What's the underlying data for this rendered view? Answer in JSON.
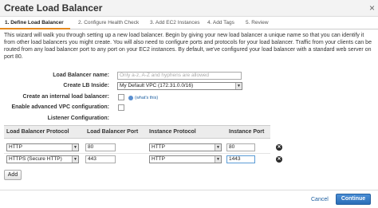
{
  "dialog": {
    "title": "Create Load Balancer",
    "close_glyph": "×"
  },
  "tabs": [
    {
      "label": "1. Define Load Balancer",
      "active": true
    },
    {
      "label": "2. Configure Health Check",
      "active": false
    },
    {
      "label": "3. Add EC2 Instances",
      "active": false
    },
    {
      "label": "4. Add Tags",
      "active": false
    },
    {
      "label": "5. Review",
      "active": false
    }
  ],
  "description": "This wizard will walk you through setting up a new load balancer. Begin by giving your new load balancer a unique name so that you can identify it from other load balancers you might create. You will also need to configure ports and protocols for your load balancer. Traffic from your clients can be routed from any load balancer port to any port on your EC2 instances. By default, we've configured your load balancer with a standard web server on port 80.",
  "form": {
    "name_label": "Load Balancer name:",
    "name_placeholder": "Only a-z, A-Z and hyphens are allowed",
    "lb_inside_label": "Create LB Inside:",
    "lb_inside_value": "My Default VPC (172.31.0.0/16)",
    "internal_label": "Create an internal load balancer:",
    "whats_this": "(what's this)",
    "advanced_vpc_label": "Enable advanced VPC configuration:",
    "listener_label": "Listener Configuration:"
  },
  "listener_table": {
    "headers": [
      "Load Balancer Protocol",
      "Load Balancer Port",
      "Instance Protocol",
      "Instance Port"
    ],
    "rows": [
      {
        "lb_protocol": "HTTP",
        "lb_port": "80",
        "instance_protocol": "HTTP",
        "instance_port": "80"
      },
      {
        "lb_protocol": "HTTPS (Secure HTTP)",
        "lb_port": "443",
        "instance_protocol": "HTTP",
        "instance_port": "1443"
      }
    ]
  },
  "buttons": {
    "add": "Add",
    "cancel": "Cancel",
    "continue": "Continue"
  },
  "colors": {
    "accent_tab": "#e58a1f",
    "link": "#1a5c9e",
    "primary_button": "#2a6db7"
  }
}
